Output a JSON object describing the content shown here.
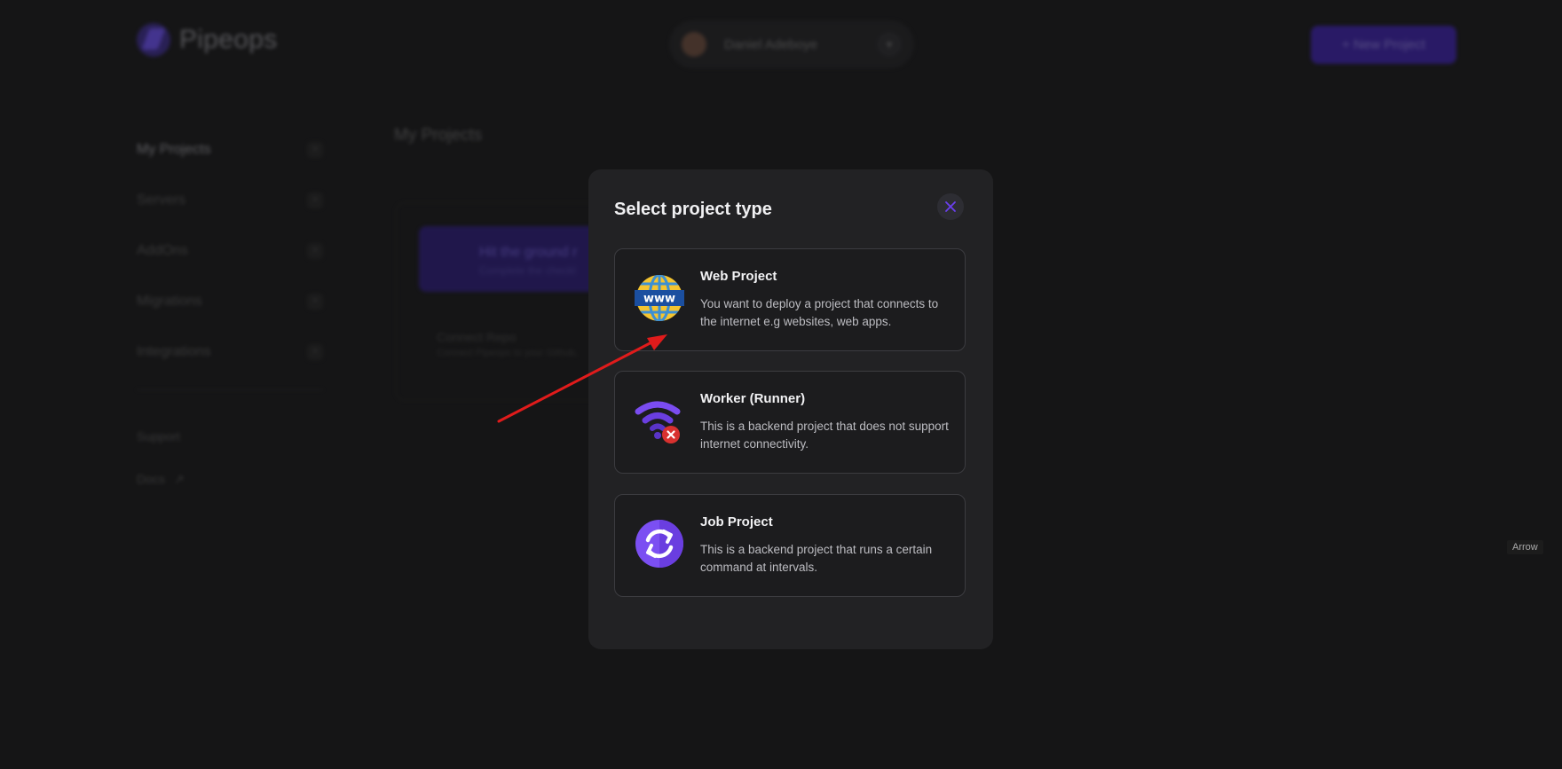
{
  "app": {
    "logo_text": "Pipeops",
    "user_name": "Daniel Adeboye",
    "new_project_label": "+  New Project"
  },
  "sidebar": {
    "items": [
      {
        "label": "My Projects",
        "badge": ">"
      },
      {
        "label": "Servers",
        "badge": ">"
      },
      {
        "label": "AddOns",
        "badge": ">"
      },
      {
        "label": "Migrations",
        "badge": ">"
      },
      {
        "label": "Integrations",
        "badge": ">"
      }
    ],
    "support_label": "Support",
    "docs_label": "Docs"
  },
  "main": {
    "title": "My Projects",
    "banner_title": "Hit the ground r",
    "banner_subtitle": "Complete the checkl",
    "connect_title": "Connect Repo",
    "connect_subtitle": "Connect Pipeops to your Github,"
  },
  "modal": {
    "title": "Select project type",
    "options": [
      {
        "title": "Web Project",
        "description": "You want to deploy a project that connects to the internet e.g websites, web apps.",
        "icon": "www-globe-icon"
      },
      {
        "title": "Worker (Runner)",
        "description": "This is a backend project that does not support internet connectivity.",
        "icon": "no-wifi-icon"
      },
      {
        "title": "Job Project",
        "description": "This is a backend project that runs a certain command at intervals.",
        "icon": "sync-icon"
      }
    ]
  },
  "annotation": {
    "tooltip_text": "Arrow",
    "arrow_color": "#e01b1b"
  },
  "colors": {
    "accent": "#6b3ff0",
    "modal_bg": "#222224",
    "page_bg": "#151516"
  }
}
